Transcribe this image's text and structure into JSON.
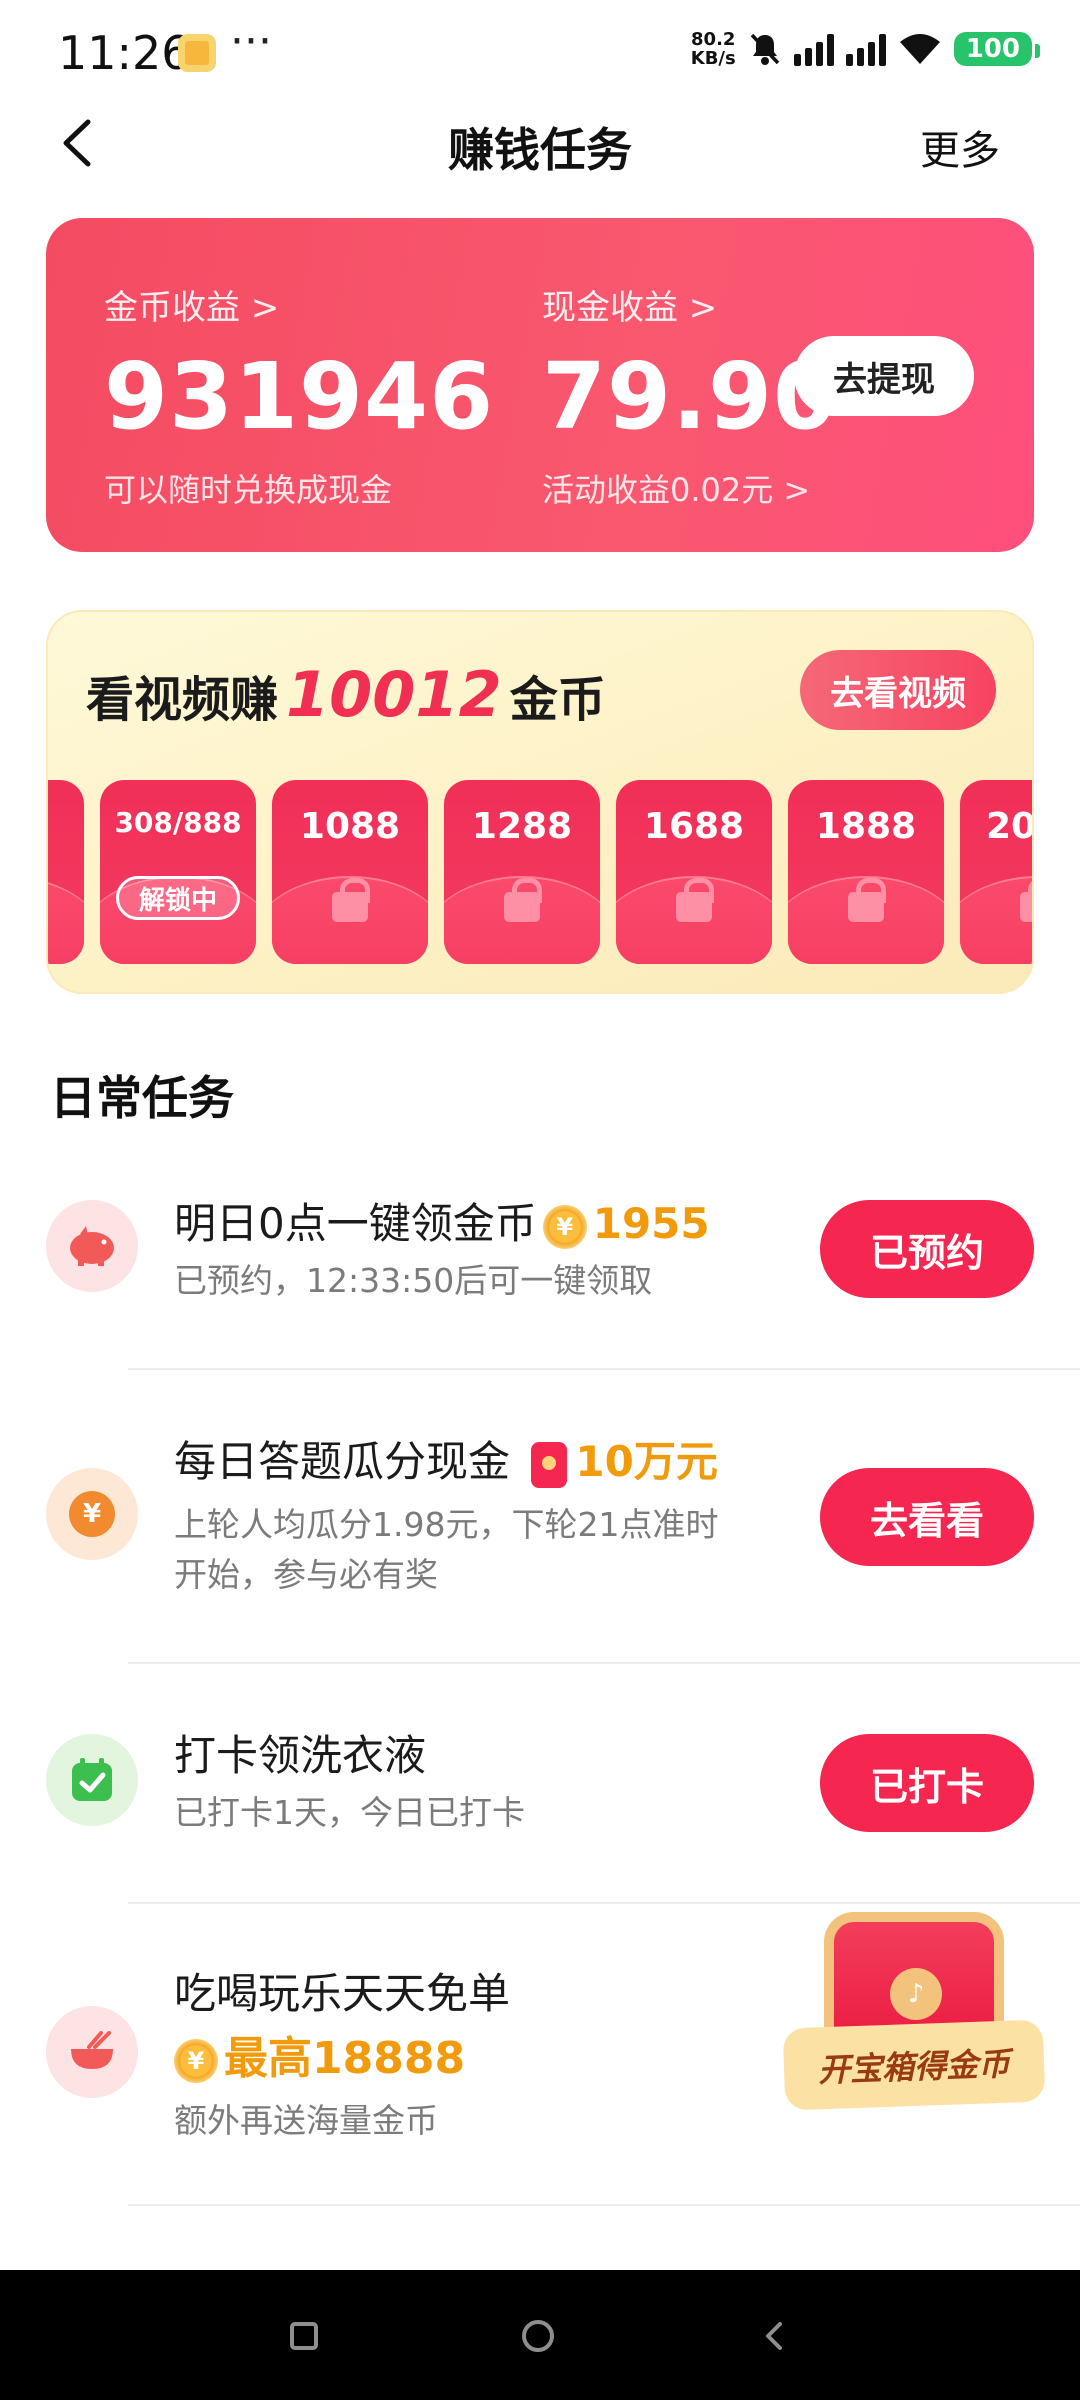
{
  "status_bar": {
    "time": "11:26",
    "more": "···",
    "net_speed_top": "80.2",
    "net_speed_bottom": "KB/s",
    "battery": "100"
  },
  "nav": {
    "title": "赚钱任务",
    "more": "更多"
  },
  "earnings": {
    "coin_label": "金币收益 >",
    "coin_value": "931946",
    "coin_sub": "可以随时兑换成现金",
    "cash_label": "现金收益 >",
    "cash_value": "79.90",
    "cash_sub": "活动收益0.02元 >",
    "withdraw_label": "去提现"
  },
  "video_task": {
    "title_prefix": "看视频赚",
    "title_number": "10012",
    "title_suffix": "金币",
    "button": "去看视频",
    "packets": [
      {
        "progress": "308/888",
        "status": "解锁中"
      },
      {
        "value": "1088"
      },
      {
        "value": "1288"
      },
      {
        "value": "1688"
      },
      {
        "value": "1888"
      },
      {
        "value": "20"
      }
    ]
  },
  "daily_section_title": "日常任务",
  "tasks": [
    {
      "title": "明日0点一键领金币",
      "reward": "1955",
      "desc": "已预约，12:33:50后可一键领取",
      "button": "已预约"
    },
    {
      "title": "每日答题瓜分现金",
      "reward": "10万元",
      "desc_line1": "上轮人均瓜分1.98元，下轮21点准时",
      "desc_line2": "开始，参与必有奖",
      "button": "去看看"
    },
    {
      "title": "打卡领洗衣液",
      "desc": "已打卡1天，今日已打卡",
      "button": "已打卡"
    },
    {
      "title": "吃喝玩乐天天免单",
      "reward": "最高18888",
      "desc": "额外再送海量金币"
    }
  ],
  "chest_label": "开宝箱得金币",
  "colors": {
    "primary": "#f5264f",
    "banner": "#f44b62",
    "coin": "#f09a0c",
    "video_bg": "#fdf1c5"
  }
}
